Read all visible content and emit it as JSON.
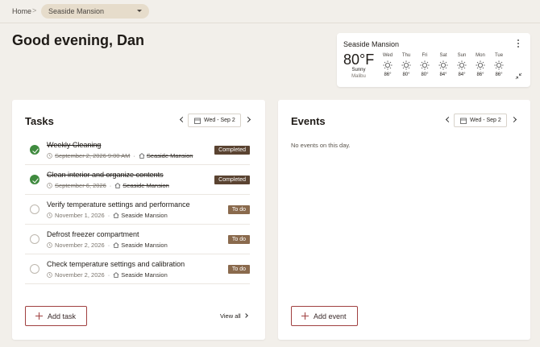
{
  "breadcrumb": {
    "home": "Home",
    "separator": ">",
    "property": "Seaside Mansion"
  },
  "greeting": "Good evening, Dan",
  "weather": {
    "location": "Seaside Mansion",
    "temperature": "80°F",
    "condition": "Sunny",
    "city": "Malibu",
    "forecast": [
      {
        "day": "Wed",
        "temp": "86°",
        "icon": "sun-icon"
      },
      {
        "day": "Thu",
        "temp": "80°",
        "icon": "sun-icon"
      },
      {
        "day": "Fri",
        "temp": "80°",
        "icon": "sun-icon"
      },
      {
        "day": "Sat",
        "temp": "84°",
        "icon": "sun-icon"
      },
      {
        "day": "Sun",
        "temp": "84°",
        "icon": "sun-icon"
      },
      {
        "day": "Mon",
        "temp": "86°",
        "icon": "sun-icon"
      },
      {
        "day": "Tue",
        "temp": "86°",
        "icon": "sun-icon"
      }
    ]
  },
  "tasks": {
    "title": "Tasks",
    "date": "Wed - Sep 2",
    "items": [
      {
        "title": "Weekly Cleaning",
        "date": "September 2, 2026 9:00 AM",
        "location": "Seaside Mansion",
        "status": "Completed"
      },
      {
        "title": "Clean interior and organize contents",
        "date": "September 6, 2026",
        "location": "Seaside Mansion",
        "status": "Completed"
      },
      {
        "title": "Verify temperature settings and performance",
        "date": "November 1, 2026",
        "location": "Seaside Mansion",
        "status": "To do"
      },
      {
        "title": "Defrost freezer compartment",
        "date": "November 2, 2026",
        "location": "Seaside Mansion",
        "status": "To do"
      },
      {
        "title": "Check temperature settings and calibration",
        "date": "November 2, 2026",
        "location": "Seaside Mansion",
        "status": "To do"
      }
    ],
    "add_label": "Add task",
    "view_all_label": "View all"
  },
  "events": {
    "title": "Events",
    "date": "Wed - Sep 2",
    "empty_text": "No events on this day.",
    "add_label": "Add event"
  },
  "colors": {
    "background": "#f2efea",
    "completed_badge": "#5a4331",
    "todo_badge": "#8a6a4d",
    "check_done": "#3f8a3e",
    "accent_border": "#a04040"
  }
}
